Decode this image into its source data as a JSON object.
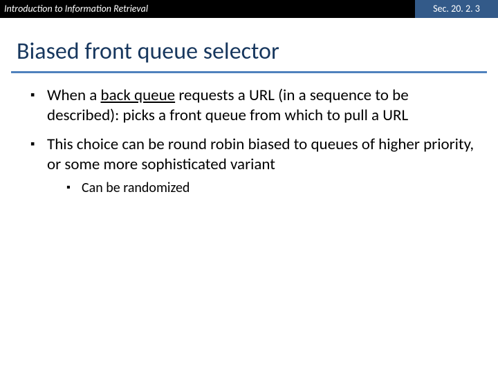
{
  "topbar": {
    "left": "Introduction to Information Retrieval",
    "right": "Sec. 20. 2. 3"
  },
  "title": "Biased front queue selector",
  "bullets": {
    "b1_pre": "When a ",
    "b1_u": "back queue",
    "b1_post": " requests a URL (in a sequence to be described): picks a front queue from which to pull a URL",
    "b2": "This choice can be round robin biased to queues of higher priority, or some more sophisticated variant",
    "b2_1": "Can be randomized"
  }
}
